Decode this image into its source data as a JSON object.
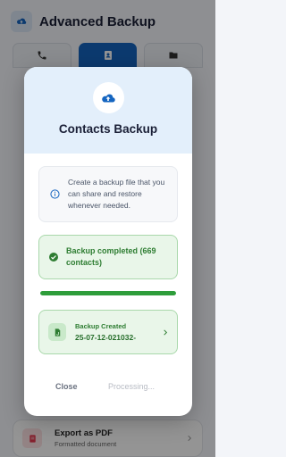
{
  "app": {
    "title": "Advanced Backup",
    "tabs": [
      {
        "icon": "phone-icon",
        "active": false
      },
      {
        "icon": "contacts-icon",
        "active": true
      },
      {
        "icon": "folder-icon",
        "active": false
      }
    ],
    "bg_item": {
      "title": "Export as PDF",
      "subtitle": "Formatted document"
    }
  },
  "dialog": {
    "title": "Contacts Backup",
    "info_text": "Create a backup file that you can share and restore whenever needed.",
    "success_text": "Backup completed (669 contacts)",
    "progress": 1.0,
    "created_label": "Backup Created",
    "created_name": "25-07-12-021032-",
    "close_label": "Close",
    "processing_label": "Processing..."
  },
  "colors": {
    "primary": "#1565c0",
    "success": "#2e7d32",
    "success_bg": "#e9f6e9",
    "header_bg": "#e3effb"
  }
}
